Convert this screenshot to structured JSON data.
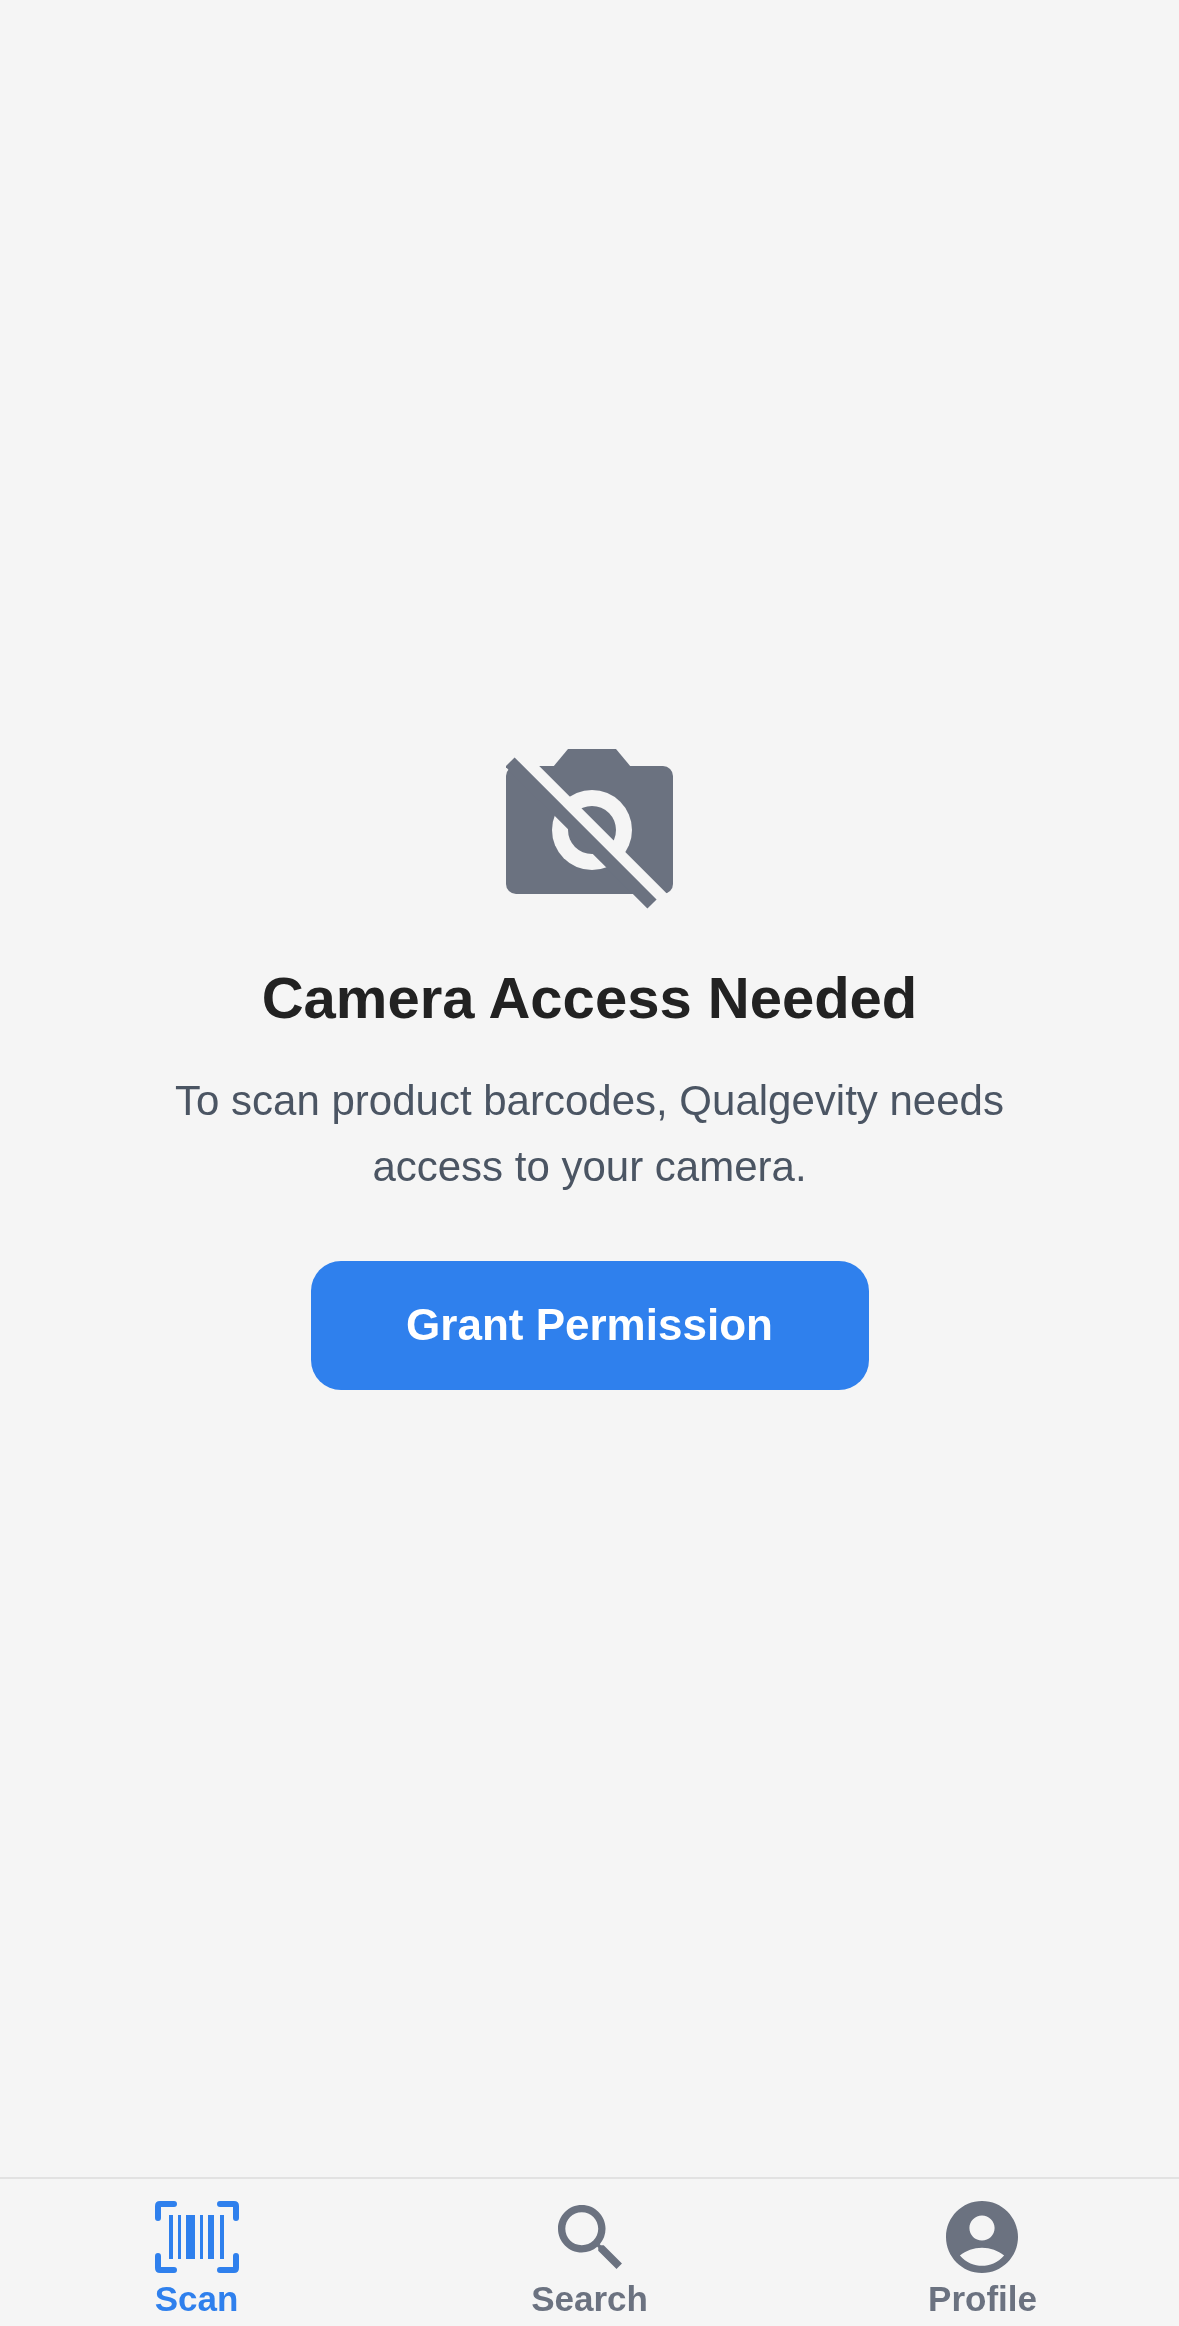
{
  "permission_prompt": {
    "title": "Camera Access Needed",
    "message": "To scan product barcodes, Qualgevity needs access to your camera.",
    "button": "Grant Permission"
  },
  "tab_bar": {
    "tabs": [
      {
        "kind": "scan",
        "label": "Scan",
        "selected": true
      },
      {
        "kind": "search",
        "label": "Search",
        "selected": false
      },
      {
        "kind": "profile",
        "label": "Profile",
        "selected": false
      }
    ]
  }
}
